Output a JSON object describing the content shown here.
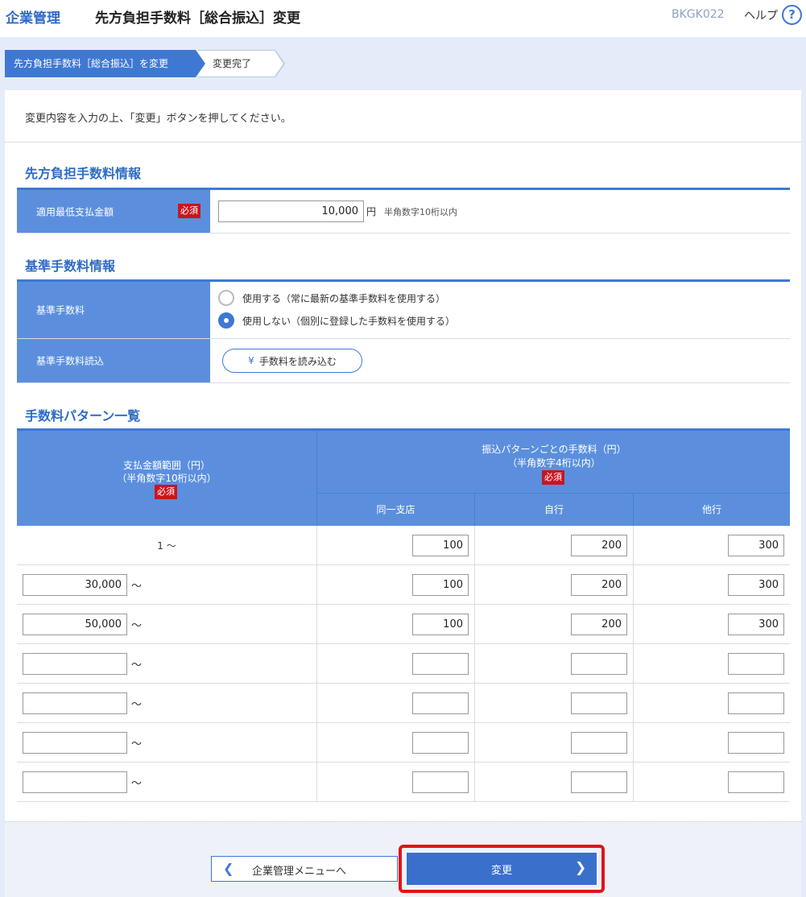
{
  "header": {
    "brand": "企業管理",
    "title": "先方負担手数料［総合振込］変更",
    "screen_id": "BKGK022",
    "help_label": "ヘルプ",
    "help_icon": "?"
  },
  "steps": {
    "current": "先方負担手数料［総合振込］を変更",
    "next": "変更完了"
  },
  "instruction": "変更内容を入力の上、「変更」ボタンを押してください。",
  "required_label": "必須",
  "section1": {
    "title": "先方負担手数料情報",
    "row_label": "適用最低支払金額",
    "amount_value": "10,000",
    "unit": "円",
    "hint": "半角数字10桁以内"
  },
  "section2": {
    "title": "基準手数料情報",
    "base_fee_label": "基準手数料",
    "option_use": "使用する（常に最新の基準手数料を使用する）",
    "option_not_use": "使用しない（個別に登録した手数料を使用する）",
    "selected": "使用しない",
    "load_label": "基準手数料読込",
    "load_button": "手数料を読み込む",
    "load_icon": "¥"
  },
  "section3": {
    "title": "手数料パターン一覧",
    "col_range_line1": "支払金額範囲（円）",
    "col_range_line2": "（半角数字10桁以内）",
    "col_fee_line1": "振込パターンごとの手数料（円）",
    "col_fee_line2": "（半角数字4桁以内）",
    "col_same_branch": "同一支店",
    "col_own_bank": "自行",
    "col_other_bank": "他行",
    "tilde": "～",
    "first_range": "1 ～",
    "rows": [
      {
        "range": "",
        "same": "100",
        "own": "200",
        "other": "300"
      },
      {
        "range": "30,000",
        "same": "100",
        "own": "200",
        "other": "300"
      },
      {
        "range": "50,000",
        "same": "100",
        "own": "200",
        "other": "300"
      },
      {
        "range": "",
        "same": "",
        "own": "",
        "other": ""
      },
      {
        "range": "",
        "same": "",
        "own": "",
        "other": ""
      },
      {
        "range": "",
        "same": "",
        "own": "",
        "other": ""
      },
      {
        "range": "",
        "same": "",
        "own": "",
        "other": ""
      }
    ]
  },
  "footer": {
    "back_button": "企業管理メニューへ",
    "change_button": "変更"
  }
}
